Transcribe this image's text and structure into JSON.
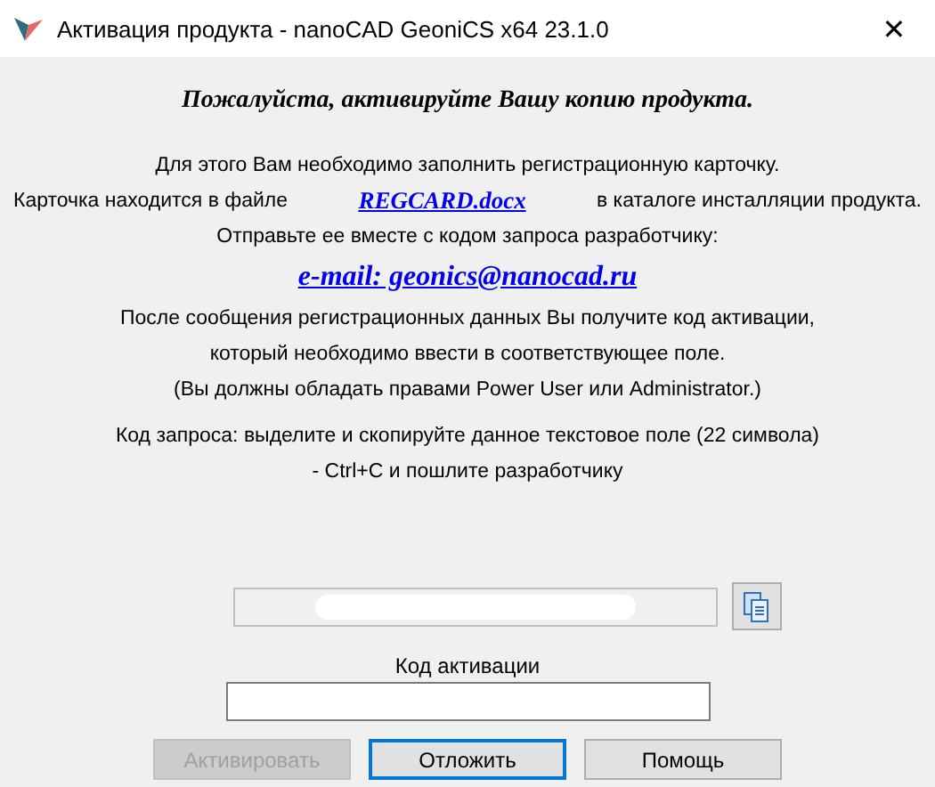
{
  "window": {
    "title": "Активация продукта - nanoCAD GeoniCS x64 23.1.0",
    "close": "✕"
  },
  "heading": "Пожалуйста, активируйте Вашу копию продукта.",
  "lines": [
    {
      "kind": "text",
      "text": "Для этого Вам необходимо заполнить регистрационную карточку."
    },
    {
      "kind": "file",
      "before": "Карточка находится в файле",
      "link": "REGCARD.docx",
      "after": "в каталоге инсталляции продукта."
    },
    {
      "kind": "text",
      "text": "Отправьте ее вместе с кодом запроса разработчику:"
    },
    {
      "kind": "email",
      "link": "e-mail: geonics@nanocad.ru"
    },
    {
      "kind": "text",
      "text": "После сообщения регистрационных данных Вы получите код активации,"
    },
    {
      "kind": "text",
      "text": "который необходимо ввести в соответствующее поле."
    },
    {
      "kind": "text",
      "text": "(Вы должны обладать правами Power User или Administrator.)"
    },
    {
      "kind": "gap"
    },
    {
      "kind": "text",
      "text": "Код запроса: выделите и скопируйте данное текстовое поле (22 символа)"
    },
    {
      "kind": "text",
      "text": "- Ctrl+C и пошлите разработчику"
    }
  ],
  "request_field": {
    "redacted": true
  },
  "activation": {
    "label": "Код активации"
  },
  "buttons": [
    {
      "label": "Активировать",
      "disabled": true,
      "selected": false
    },
    {
      "label": "Отложить",
      "disabled": false,
      "selected": true
    },
    {
      "label": "Помощь",
      "disabled": false,
      "selected": false
    }
  ]
}
